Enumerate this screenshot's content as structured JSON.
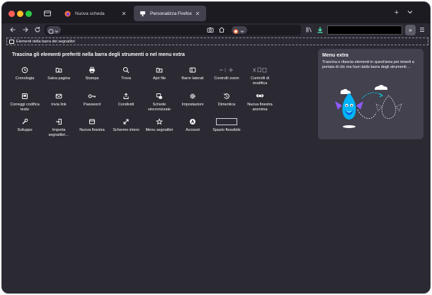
{
  "tabs": [
    {
      "label": "Nuova scheda",
      "active": false
    },
    {
      "label": "Personalizza Firefox",
      "active": true
    }
  ],
  "bookmarks_bar": {
    "label": "Elementi della barra dei segnalibri"
  },
  "palette": {
    "title": "Trascina gli elementi preferiti nella barra degli strumenti o nel menu extra",
    "items": [
      {
        "label": "Cronologia",
        "icon": "clock-icon"
      },
      {
        "label": "Salva pagina",
        "icon": "folder-icon"
      },
      {
        "label": "Stampa",
        "icon": "printer-icon"
      },
      {
        "label": "Trova",
        "icon": "magnifier-icon"
      },
      {
        "label": "Apri file",
        "icon": "open-folder-icon"
      },
      {
        "label": "Barre laterali",
        "icon": "sidebar-icon"
      },
      {
        "label": "Controlli zoom",
        "icon": "zoom-controls-icon"
      },
      {
        "label": "Controlli di modifica",
        "icon": "edit-controls-icon"
      },
      {
        "label": "Correggi codifica testo",
        "icon": "text-encoding-icon"
      },
      {
        "label": "Invia link",
        "icon": "mail-icon"
      },
      {
        "label": "Password",
        "icon": "key-icon"
      },
      {
        "label": "Condividi",
        "icon": "share-icon"
      },
      {
        "label": "Schede sincronizzate",
        "icon": "synced-tabs-icon"
      },
      {
        "label": "Impostazioni",
        "icon": "gear-icon"
      },
      {
        "label": "Dimentica",
        "icon": "forget-icon"
      },
      {
        "label": "Nuova finestra anonima",
        "icon": "private-mask-icon"
      },
      {
        "label": "Sviluppo",
        "icon": "wrench-icon"
      },
      {
        "label": "Importa segnalibri…",
        "icon": "import-icon"
      },
      {
        "label": "Nuova finestra",
        "icon": "window-icon"
      },
      {
        "label": "Schermo intero",
        "icon": "fullscreen-icon"
      },
      {
        "label": "Menu segnalibri",
        "icon": "bookmark-star-icon"
      },
      {
        "label": "Account",
        "icon": "account-icon"
      },
      {
        "label": "Spazio flessibile",
        "icon": "flexible-space-icon"
      }
    ]
  },
  "overflow_panel": {
    "title": "Menu extra",
    "description": "Trascina e rilascia elementi in quest'area per tenerli a portata di clic ma fuori dalla barra degli strumenti…"
  },
  "colors": {
    "window_bg": "#2b2a33",
    "tabbar_bg": "#1c1b22",
    "active_tab": "#42414d",
    "accent_teal": "#00ddff",
    "download_teal": "#54ffbd"
  }
}
